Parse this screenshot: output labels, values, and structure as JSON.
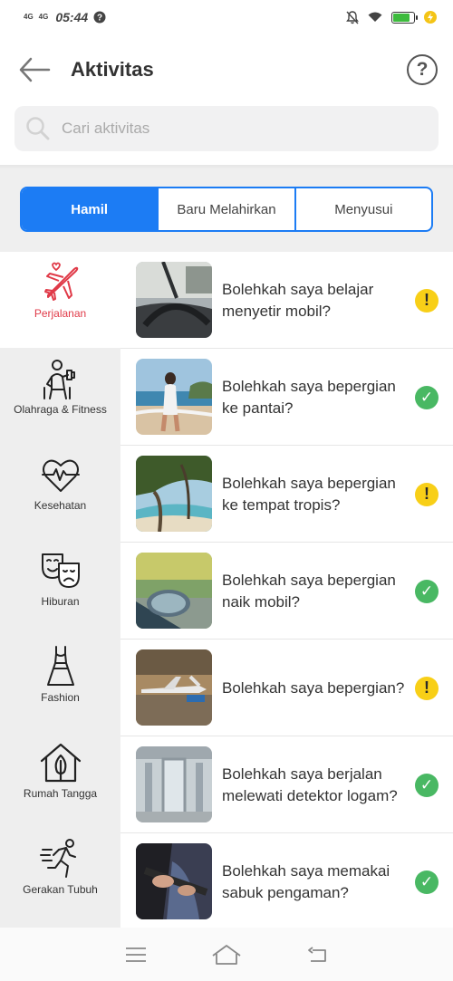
{
  "status_bar": {
    "net1": "4G",
    "net2": "4G",
    "time": "05:44",
    "battery_level": 0.8
  },
  "header": {
    "title": "Aktivitas",
    "help_label": "?"
  },
  "search": {
    "placeholder": "Cari aktivitas"
  },
  "tabs": [
    {
      "label": "Hamil",
      "active": true
    },
    {
      "label": "Baru Melahirkan",
      "active": false
    },
    {
      "label": "Menyusui",
      "active": false
    }
  ],
  "sidebar": {
    "items": [
      {
        "label": "Perjalanan",
        "icon": "airplane-icon",
        "active": true
      },
      {
        "label": "Olahraga & Fitness",
        "icon": "fitness-icon",
        "active": false
      },
      {
        "label": "Kesehatan",
        "icon": "heartbeat-icon",
        "active": false
      },
      {
        "label": "Hiburan",
        "icon": "theater-masks-icon",
        "active": false
      },
      {
        "label": "Fashion",
        "icon": "dress-icon",
        "active": false
      },
      {
        "label": "Rumah Tangga",
        "icon": "house-leaf-icon",
        "active": false
      },
      {
        "label": "Gerakan Tubuh",
        "icon": "running-person-icon",
        "active": false
      }
    ]
  },
  "activities": [
    {
      "question": "Bolehkah saya belajar menyetir mobil?",
      "status": "caution",
      "status_icon": "exclamation-icon",
      "image": "car-steering-photo"
    },
    {
      "question": "Bolehkah saya bepergian ke pantai?",
      "status": "safe",
      "status_icon": "check-icon",
      "image": "beach-photo"
    },
    {
      "question": "Bolehkah saya bepergian ke tempat tropis?",
      "status": "caution",
      "status_icon": "exclamation-icon",
      "image": "tropical-photo"
    },
    {
      "question": "Bolehkah saya bepergian naik mobil?",
      "status": "safe",
      "status_icon": "check-icon",
      "image": "car-mirror-photo"
    },
    {
      "question": "Bolehkah saya bepergian?",
      "status": "caution",
      "status_icon": "exclamation-icon",
      "image": "airplane-photo"
    },
    {
      "question": "Bolehkah saya berjalan melewati detektor logam?",
      "status": "safe",
      "status_icon": "check-icon",
      "image": "metal-detector-photo"
    },
    {
      "question": "Bolehkah saya memakai sabuk pengaman?",
      "status": "safe",
      "status_icon": "check-icon",
      "image": "seatbelt-photo"
    }
  ],
  "colors": {
    "accent": "#1c7cf4",
    "active_sidebar": "#e03a48",
    "caution": "#f8cf17",
    "safe": "#49b863"
  }
}
